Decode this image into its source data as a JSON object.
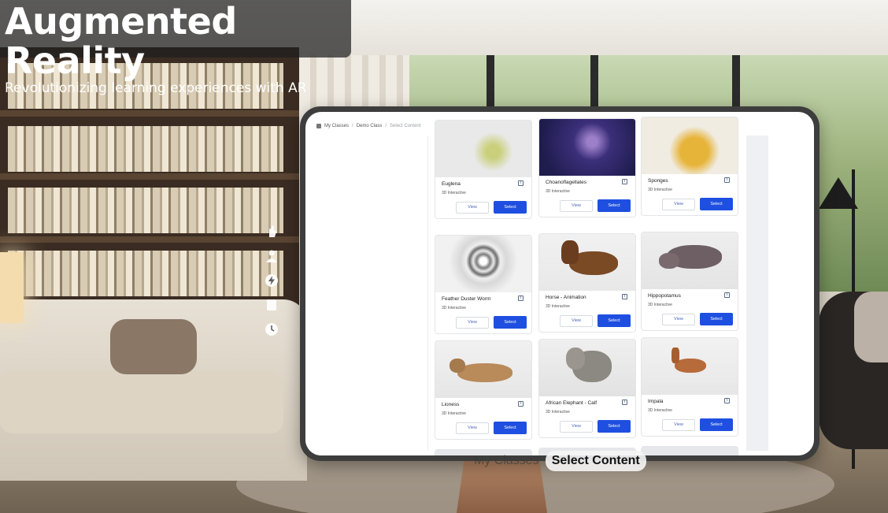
{
  "overlay": {
    "title": "Augmented Reality",
    "subtitle": "Revolutionizing learning experiences with AR"
  },
  "sidebar": {
    "icons": [
      "hand-icon",
      "person-icon",
      "lightning-icon",
      "document-icon",
      "clock-icon"
    ]
  },
  "app": {
    "breadcrumb": [
      "My Classes",
      "Demo Class",
      "Select Content"
    ],
    "breadcrumb_separator": "/",
    "cards": [
      {
        "name": "Euglena",
        "type": "3D Interactive",
        "view": "View",
        "select": "Select"
      },
      {
        "name": "Choanoflagellates",
        "type": "3D Interactive",
        "view": "View",
        "select": "Select"
      },
      {
        "name": "Sponges",
        "type": "3D Interactive",
        "view": "View",
        "select": "Select"
      },
      {
        "name": "Feather Duster Worm",
        "type": "3D Interactive",
        "view": "View",
        "select": "Select"
      },
      {
        "name": "Horse - Animation",
        "type": "3D Interactive",
        "view": "View",
        "select": "Select"
      },
      {
        "name": "Hippopotamus",
        "type": "3D Interactive",
        "view": "View",
        "select": "Select"
      },
      {
        "name": "Lioness",
        "type": "3D Interactive",
        "view": "View",
        "select": "Select"
      },
      {
        "name": "African Elephant - Calf",
        "type": "3D Interactive",
        "view": "View",
        "select": "Select"
      },
      {
        "name": "Impala",
        "type": "3D Interactive",
        "view": "View",
        "select": "Select"
      }
    ],
    "info_glyph": "i"
  },
  "bottom_nav": {
    "items": [
      "My Classes",
      "Select Content"
    ],
    "active": "Select Content"
  },
  "colors": {
    "select_button": "#1e4fe0",
    "tablet_frame": "#3d3d3d"
  }
}
